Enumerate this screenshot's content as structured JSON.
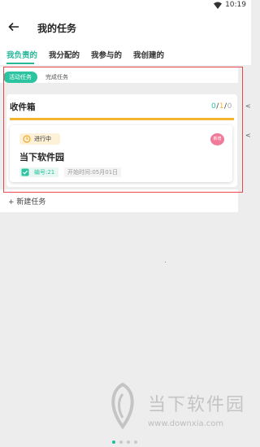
{
  "status_bar": {
    "time": "10:19",
    "wifi_icon": "wifi-icon"
  },
  "app_bar": {
    "back_icon": "arrow-left-icon",
    "title": "我的任务"
  },
  "tabs": [
    {
      "label": "我负责的",
      "active": true
    },
    {
      "label": "我分配的",
      "active": false
    },
    {
      "label": "我参与的",
      "active": false
    },
    {
      "label": "我创建的",
      "active": false
    }
  ],
  "filters": {
    "active_label": "活动任务",
    "done_label": "完成任务"
  },
  "inbox": {
    "title": "收件箱",
    "count": {
      "a": "0",
      "b": "1",
      "c": "0",
      "sep": "/"
    },
    "progress_color": "#f5b52e"
  },
  "task": {
    "status": "进行中",
    "badge": "新增",
    "title": "当下软件园",
    "number": "编号:21",
    "start": "开始时间:05月01日"
  },
  "new_task": "+ 新建任务",
  "edge_marks": [
    "<",
    "<"
  ],
  "pager": {
    "count": 4,
    "current": 0
  },
  "watermark": {
    "name": "当下软件园",
    "url": "www.downxia.com"
  },
  "colors": {
    "accent": "#27b89a",
    "highlight": "#e8474d",
    "badge": "#f07a9a"
  }
}
